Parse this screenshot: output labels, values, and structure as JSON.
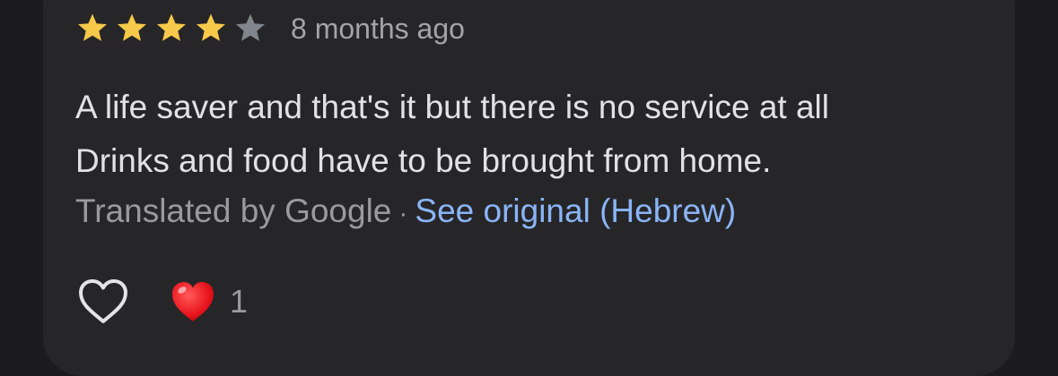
{
  "review": {
    "rating": 4,
    "max_rating": 5,
    "colors": {
      "star_filled": "#f6c94a",
      "star_empty": "#80868b",
      "link": "#8ab4f8"
    },
    "time_ago": "8 months ago",
    "text_lines": [
      "A life saver and that's it but there is no service at all",
      "Drinks and food have to be brought from home."
    ],
    "translation": {
      "by_label": "Translated by Google",
      "separator": "·",
      "see_original_label": "See original (Hebrew)"
    },
    "actions": {
      "like_icon": "heart-outline-icon",
      "reaction_icon": "red-heart-icon",
      "reaction_count": "1"
    }
  }
}
